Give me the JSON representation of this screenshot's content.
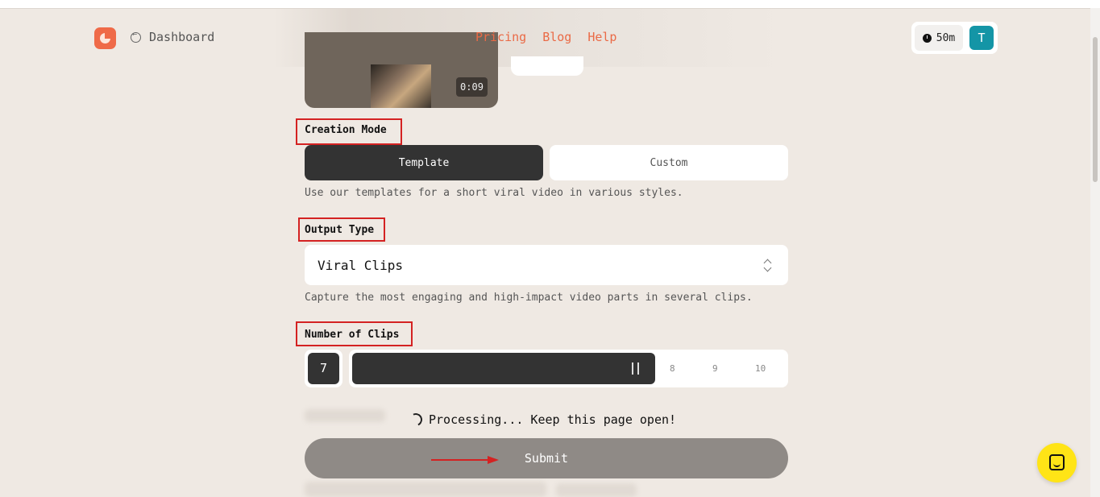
{
  "header": {
    "back_label": "Dashboard",
    "nav": [
      "Pricing",
      "Blog",
      "Help"
    ],
    "credits": "50m",
    "avatar_initial": "T"
  },
  "video": {
    "duration": "0:09"
  },
  "creation_mode": {
    "label": "Creation Mode",
    "options": [
      "Template",
      "Custom"
    ],
    "selected": "Template",
    "description": "Use our templates for a short viral video in various styles."
  },
  "output_type": {
    "label": "Output Type",
    "selected": "Viral Clips",
    "description": "Capture the most engaging and high-impact video parts in several clips."
  },
  "clips": {
    "label": "Number of Clips",
    "value": "7",
    "ticks": [
      "8",
      "9",
      "10"
    ]
  },
  "status": {
    "processing_text": "Processing... Keep this page open!",
    "submit_label": "Submit"
  },
  "colors": {
    "accent": "#ea6a46",
    "annotation": "#d42222",
    "avatar": "#1495a6",
    "chat": "#ffe416"
  }
}
